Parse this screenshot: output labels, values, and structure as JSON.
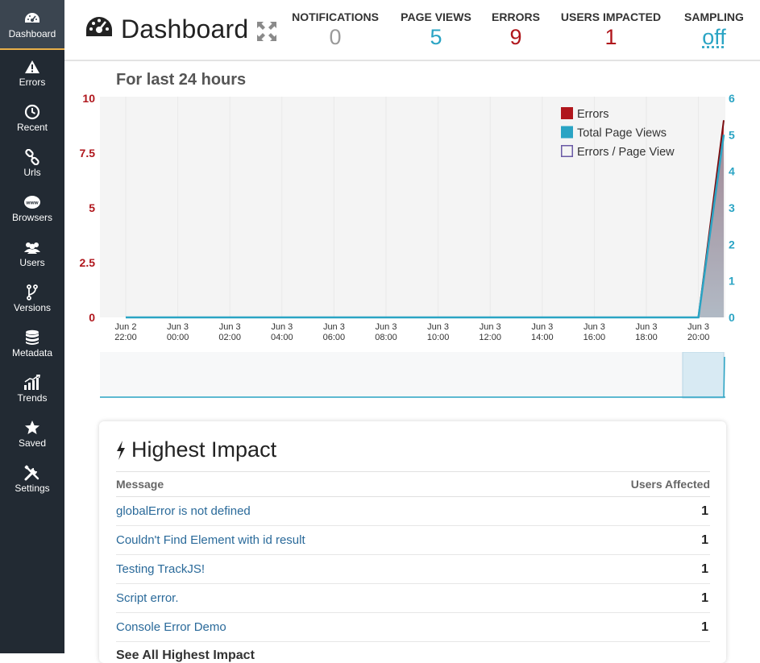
{
  "sidebar": {
    "items": [
      {
        "label": "Dashboard",
        "icon": "dashboard-icon"
      },
      {
        "label": "Errors",
        "icon": "warning-icon"
      },
      {
        "label": "Recent",
        "icon": "clock-icon"
      },
      {
        "label": "Urls",
        "icon": "link-icon"
      },
      {
        "label": "Browsers",
        "icon": "www-icon"
      },
      {
        "label": "Users",
        "icon": "users-icon"
      },
      {
        "label": "Versions",
        "icon": "branch-icon"
      },
      {
        "label": "Metadata",
        "icon": "database-icon"
      },
      {
        "label": "Trends",
        "icon": "trends-icon"
      },
      {
        "label": "Saved",
        "icon": "star-icon"
      },
      {
        "label": "Settings",
        "icon": "tools-icon"
      }
    ]
  },
  "header": {
    "title": "Dashboard",
    "stats": [
      {
        "label": "NOTIFICATIONS",
        "value": "0",
        "color": "#9a9a9a"
      },
      {
        "label": "PAGE VIEWS",
        "value": "5",
        "color": "#2aa4c4"
      },
      {
        "label": "ERRORS",
        "value": "9",
        "color": "#b0161c"
      },
      {
        "label": "USERS IMPACTED",
        "value": "1",
        "color": "#b0161c"
      },
      {
        "label": "SAMPLING",
        "value": "off",
        "color": "#2aa4c4"
      }
    ]
  },
  "chart": {
    "title": "For last 24 hours"
  },
  "chart_data": {
    "type": "area",
    "x": [
      "Jun 2 22:00",
      "Jun 3 00:00",
      "Jun 3 02:00",
      "Jun 3 04:00",
      "Jun 3 06:00",
      "Jun 3 08:00",
      "Jun 3 10:00",
      "Jun 3 12:00",
      "Jun 3 14:00",
      "Jun 3 16:00",
      "Jun 3 18:00",
      "Jun 3 20:00",
      "Jun 3 20:30"
    ],
    "x_ticks": [
      {
        "line1": "Jun 2",
        "line2": "22:00"
      },
      {
        "line1": "Jun 3",
        "line2": "00:00"
      },
      {
        "line1": "Jun 3",
        "line2": "02:00"
      },
      {
        "line1": "Jun 3",
        "line2": "04:00"
      },
      {
        "line1": "Jun 3",
        "line2": "06:00"
      },
      {
        "line1": "Jun 3",
        "line2": "08:00"
      },
      {
        "line1": "Jun 3",
        "line2": "10:00"
      },
      {
        "line1": "Jun 3",
        "line2": "12:00"
      },
      {
        "line1": "Jun 3",
        "line2": "14:00"
      },
      {
        "line1": "Jun 3",
        "line2": "16:00"
      },
      {
        "line1": "Jun 3",
        "line2": "18:00"
      },
      {
        "line1": "Jun 3",
        "line2": "20:00"
      }
    ],
    "series": [
      {
        "name": "Errors",
        "axis": "left",
        "color": "#b0161c",
        "values": [
          0,
          0,
          0,
          0,
          0,
          0,
          0,
          0,
          0,
          0,
          0,
          0,
          9
        ]
      },
      {
        "name": "Total Page Views",
        "axis": "right",
        "color": "#2aa4c4",
        "values": [
          0,
          0,
          0,
          0,
          0,
          0,
          0,
          0,
          0,
          0,
          0,
          0,
          5
        ]
      },
      {
        "name": "Errors / Page View",
        "axis": "right",
        "color": "#6a5aa6",
        "values": []
      }
    ],
    "y_left": {
      "ticks": [
        "10",
        "7.5",
        "5",
        "2.5",
        "0"
      ],
      "ylim": [
        0,
        10
      ],
      "color": "#b0161c"
    },
    "y_right": {
      "ticks": [
        "6",
        "5",
        "4",
        "3",
        "2",
        "1",
        "0"
      ],
      "ylim": [
        0,
        6
      ],
      "color": "#2aa4c4"
    },
    "legend_position": "top-right",
    "grid": true
  },
  "impact": {
    "title": "Highest Impact",
    "col_message": "Message",
    "col_users": "Users Affected",
    "rows": [
      {
        "message": "globalError is not defined",
        "users": "1"
      },
      {
        "message": "Couldn't Find Element with id result",
        "users": "1"
      },
      {
        "message": "Testing TrackJS!",
        "users": "1"
      },
      {
        "message": "Script error.",
        "users": "1"
      },
      {
        "message": "Console Error Demo",
        "users": "1"
      }
    ],
    "more": "See All Highest Impact"
  }
}
